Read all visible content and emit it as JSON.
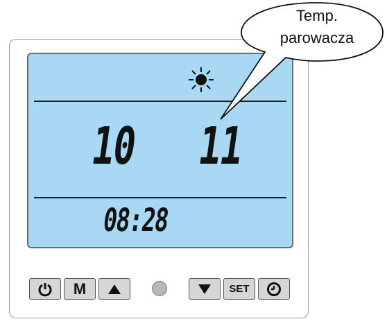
{
  "lcd": {
    "left_value": "10",
    "right_value": "11",
    "clock": "08:28",
    "mode_icon": "sun-icon"
  },
  "callout": {
    "line1": "Temp.",
    "line2": "parowacza"
  },
  "buttons": {
    "power": "power-icon",
    "mode_label": "M",
    "up": "up-arrow-icon",
    "down": "down-arrow-icon",
    "set_label": "SET",
    "clock": "clock-icon"
  },
  "colors": {
    "lcd_background": "#a8d8f4",
    "button_background": "#d6d6d6",
    "led": "#b8b8b8"
  }
}
